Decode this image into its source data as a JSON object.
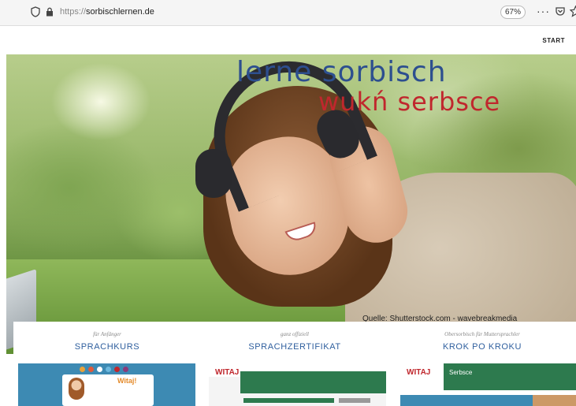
{
  "browser": {
    "url_prefix": "https://",
    "url_host": "sorbischlernen.de",
    "zoom": "67%",
    "menu_dots": "···"
  },
  "nav": {
    "start": "START"
  },
  "hero": {
    "title_de": "lerne sorbisch",
    "title_hsb": "wukń serbsce",
    "credit": "Quelle: Shutterstock.com - wavebreakmedia"
  },
  "sections": [
    {
      "subtitle": "für Anfänger",
      "heading": "SPRACHKURS"
    },
    {
      "subtitle": "ganz offiziell",
      "heading": "SPRACHZERTIFIKAT"
    },
    {
      "subtitle": "Obersorbisch für Muttersprachler",
      "heading": "KROK PO KROKU"
    }
  ],
  "thumbs": {
    "witaj": "Witaj!",
    "logo": "WITAJ",
    "serbsce": "Serbsce"
  },
  "colors": {
    "title_blue": "#2d4f8f",
    "title_red": "#c0272d",
    "heading_blue": "#2f5f9e",
    "green": "#2d7a4e"
  }
}
